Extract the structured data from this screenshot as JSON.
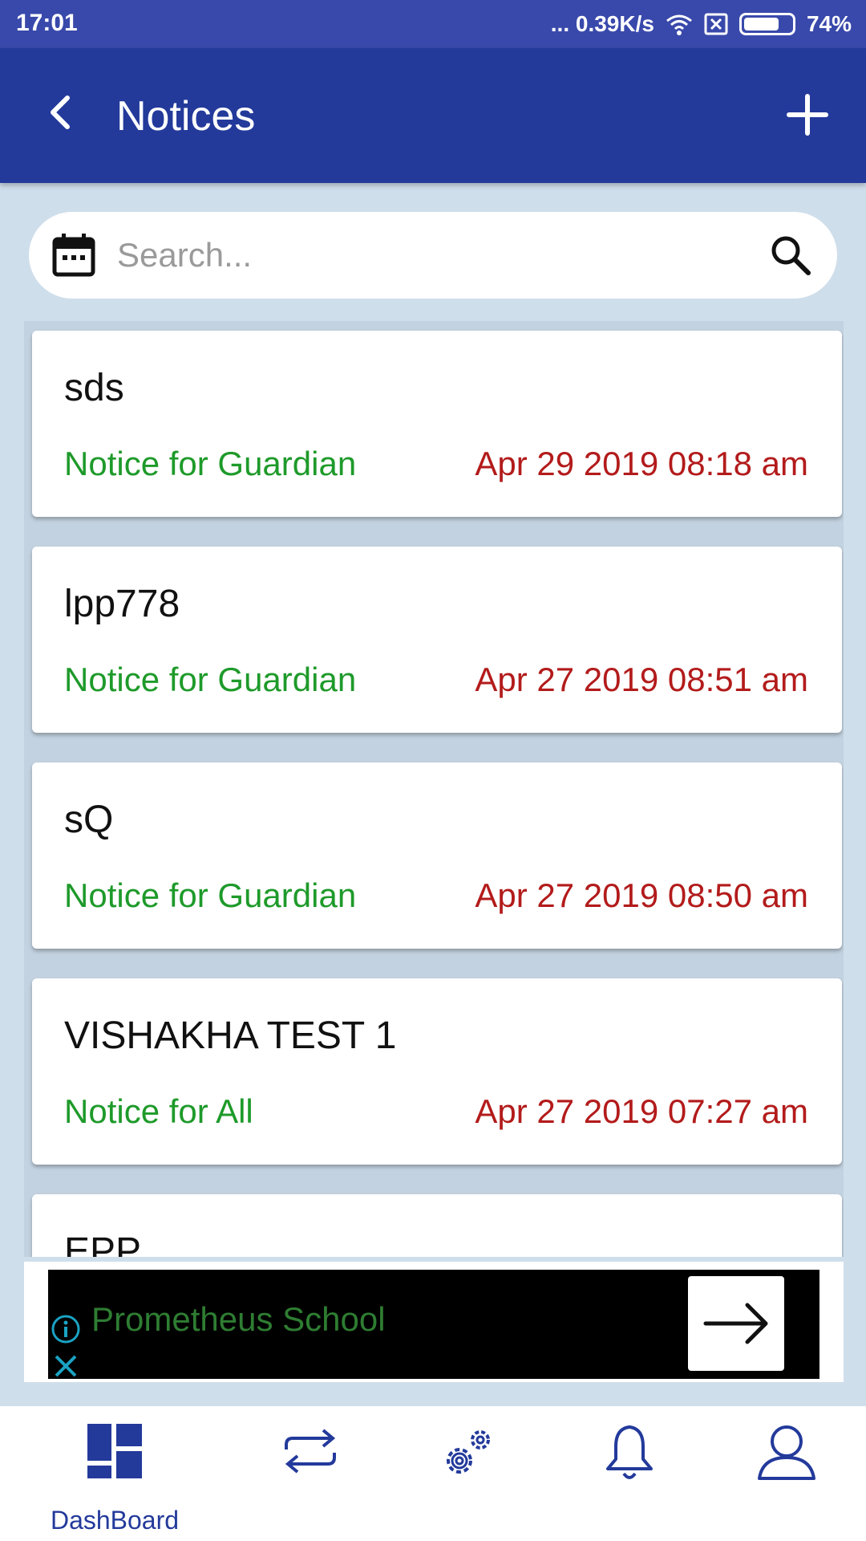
{
  "status_bar": {
    "time": "17:01",
    "network_speed": "... 0.39K/s",
    "battery_text": "74%",
    "battery_level": 0.74
  },
  "app_bar": {
    "title": "Notices",
    "back_icon": "back-arrow-icon",
    "add_icon": "plus-icon"
  },
  "search": {
    "placeholder": "Search...",
    "value": "",
    "left_icon": "calendar-icon",
    "right_icon": "search-icon"
  },
  "notices": [
    {
      "title": "sds",
      "audience": "Notice for Guardian",
      "date": "Apr 29 2019 08:18 am"
    },
    {
      "title": "lpp778",
      "audience": "Notice for Guardian",
      "date": "Apr 27 2019 08:51 am"
    },
    {
      "title": "sQ",
      "audience": "Notice for Guardian",
      "date": "Apr 27 2019 08:50 am"
    },
    {
      "title": "VISHAKHA TEST 1",
      "audience": "Notice for All",
      "date": "Apr 27 2019 07:27 am"
    },
    {
      "title": "EPP",
      "audience": "",
      "date": ""
    }
  ],
  "ad": {
    "name": "Prometheus School",
    "info_icon": "info-icon",
    "close_icon": "close-icon",
    "arrow_icon": "arrow-right-icon"
  },
  "bottom_nav": {
    "items": [
      {
        "icon": "dashboard-icon",
        "label": "DashBoard",
        "active": true
      },
      {
        "icon": "swap-icon",
        "label": ""
      },
      {
        "icon": "settings-gears-icon",
        "label": ""
      },
      {
        "icon": "bell-icon",
        "label": ""
      },
      {
        "icon": "user-icon",
        "label": ""
      }
    ]
  },
  "colors": {
    "app_bar": "#233a9b",
    "status_bar": "#3949ab",
    "background": "#cfdeeb",
    "audience_text": "#1e9a2a",
    "date_text": "#b31b1b"
  }
}
